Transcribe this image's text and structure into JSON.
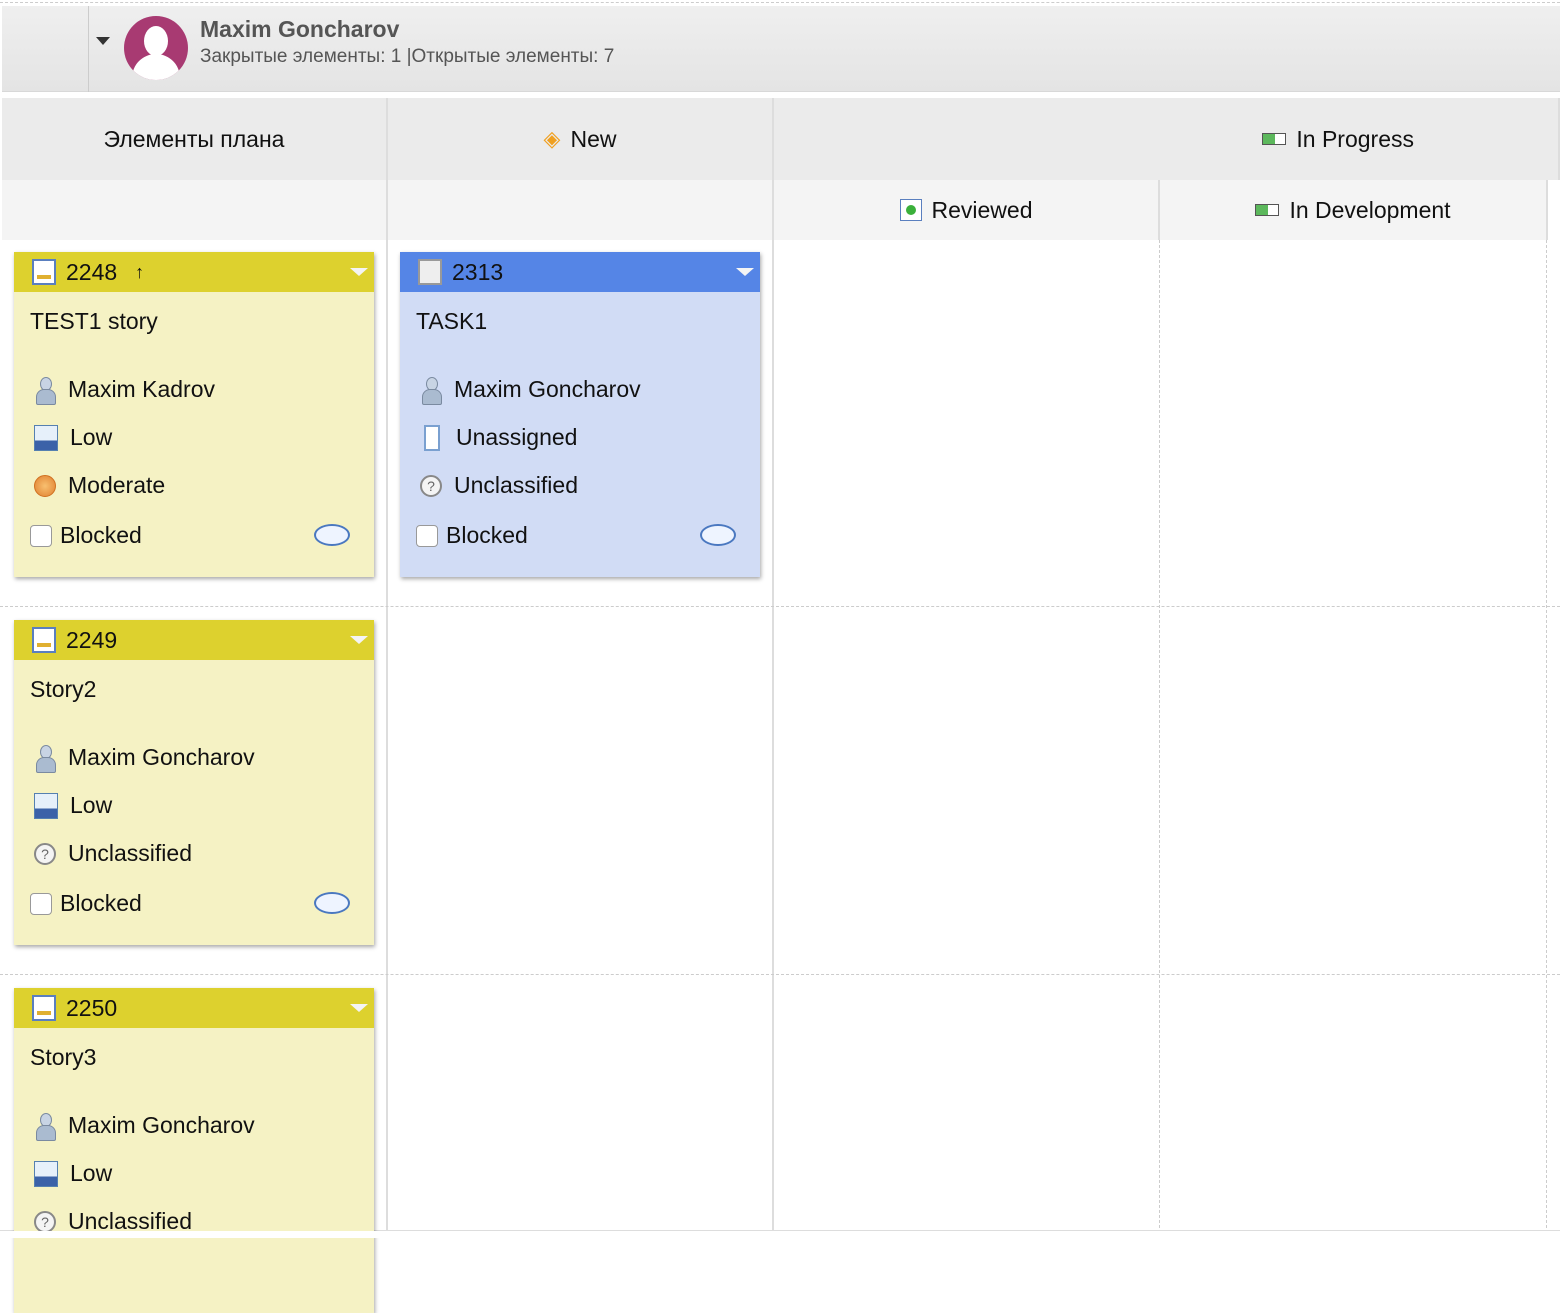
{
  "owner": {
    "name": "Maxim Goncharov",
    "stats": "Закрытые элементы: 1 |Открытые элементы: 7"
  },
  "columns": {
    "plan_items": "Элементы плана",
    "new": "New",
    "in_progress": "In Progress",
    "reviewed": "Reviewed",
    "in_development": "In Development"
  },
  "cards": [
    {
      "id": "2248",
      "type": "story",
      "title": "TEST1 story",
      "owner": "Maxim Kadrov",
      "priority": "Low",
      "severity": "Moderate",
      "blocked": "Blocked",
      "has_parent_arrow": true
    },
    {
      "id": "2313",
      "type": "task",
      "title": "TASK1",
      "owner": "Maxim Goncharov",
      "priority": "Unassigned",
      "severity": "Unclassified",
      "blocked": "Blocked"
    },
    {
      "id": "2249",
      "type": "story",
      "title": "Story2",
      "owner": "Maxim Goncharov",
      "priority": "Low",
      "severity": "Unclassified",
      "blocked": "Blocked"
    },
    {
      "id": "2250",
      "type": "story",
      "title": "Story3",
      "owner": "Maxim Goncharov",
      "priority": "Low",
      "severity": "Unclassified"
    }
  ],
  "colors": {
    "story_header": "#ddd12e",
    "story_body": "#f5f2c4",
    "task_header": "#5585e6",
    "task_body": "#d1dcf5",
    "avatar": "#a83a72"
  }
}
